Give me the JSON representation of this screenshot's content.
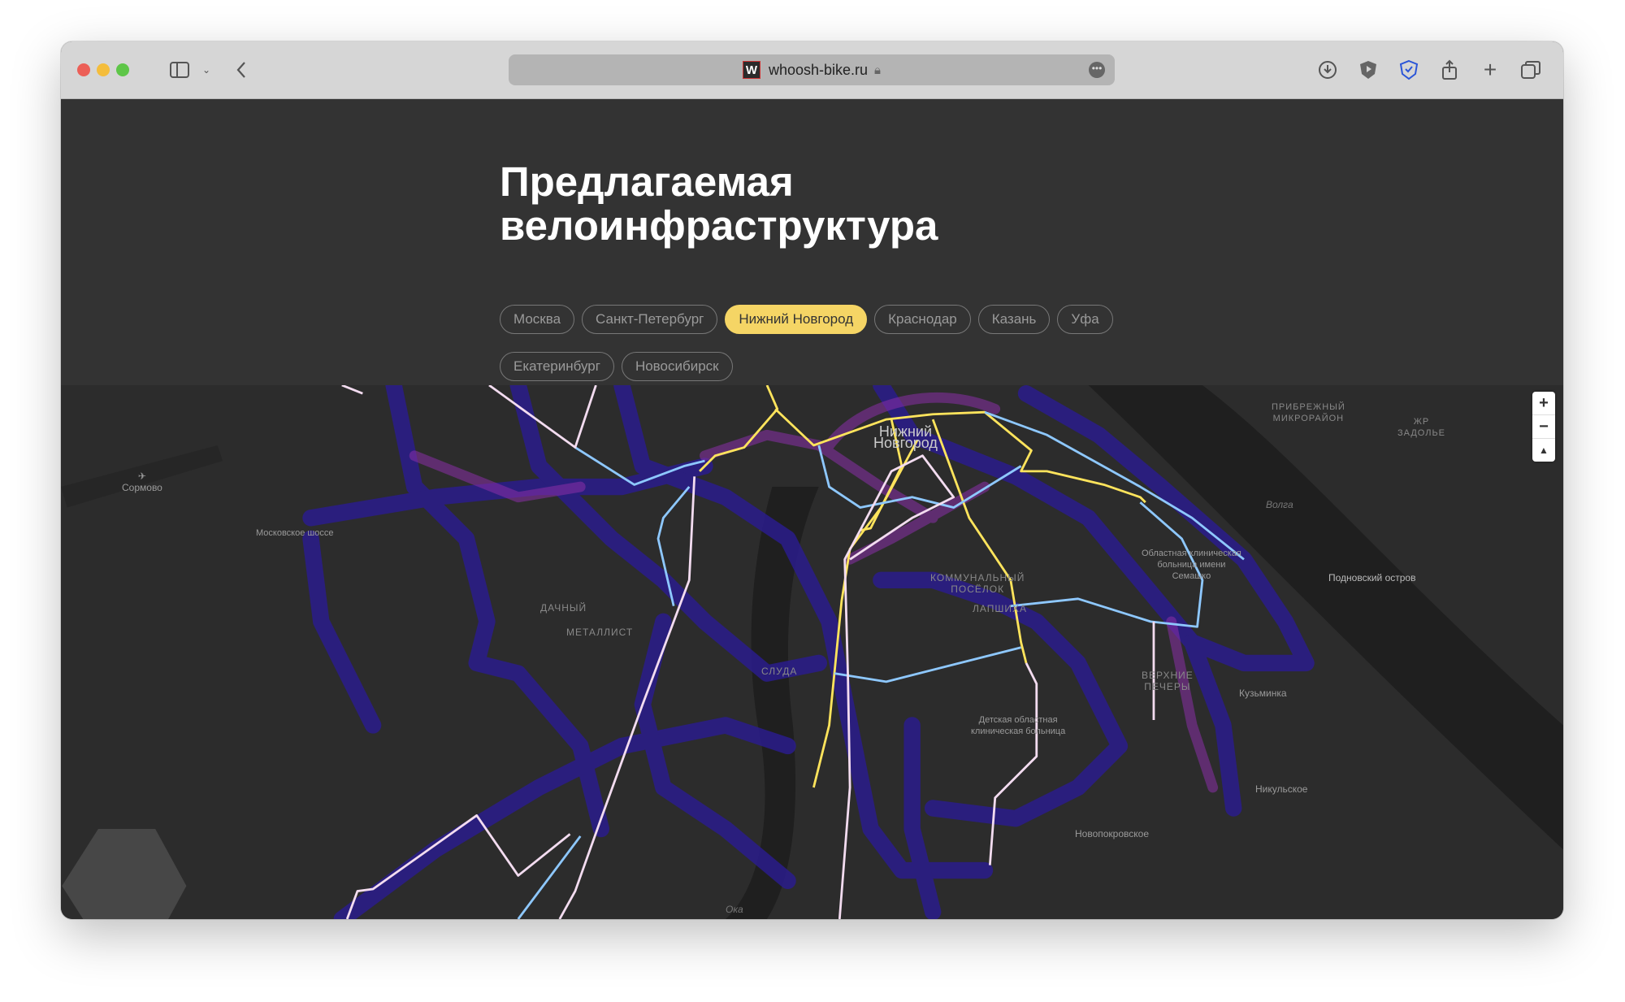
{
  "browser": {
    "url": "whoosh-bike.ru",
    "favicon_letter": "W",
    "icons": [
      "sidebar-icon",
      "chevron-down-icon",
      "back-icon",
      "lock-icon",
      "more-icon",
      "download-icon",
      "shield-icon",
      "password-shield-icon",
      "share-icon",
      "new-tab-icon",
      "tabs-icon"
    ]
  },
  "page": {
    "title_line1": "Предлагаемая",
    "title_line2": "велоинфраструктура",
    "cities": [
      {
        "label": "Москва",
        "active": false
      },
      {
        "label": "Санкт-Петербург",
        "active": false
      },
      {
        "label": "Нижний Новгород",
        "active": true
      },
      {
        "label": "Краснодар",
        "active": false
      },
      {
        "label": "Казань",
        "active": false
      },
      {
        "label": "Уфа",
        "active": false
      },
      {
        "label": "Екатеринбург",
        "active": false
      },
      {
        "label": "Новосибирск",
        "active": false
      }
    ],
    "accent_color": "#f5d565"
  },
  "map": {
    "labels": {
      "city": "Нижний\nНовгород",
      "sormovo": "Сормово",
      "moskovskoe": "Московское шоссе",
      "dachny": "ДАЧНЫЙ",
      "metallist": "МЕТАЛЛИСТ",
      "sluda": "СЛУДА",
      "kommunalny": "КОММУНАЛЬНЫЙ\nПОСЁЛОК",
      "lapshikha": "ЛАПШИХА",
      "hospital_region": "Областная клиническая\nбольница имени\nСемашко",
      "hospital_child": "Детская областная\nклиническая больница",
      "verkhnie": "ВЕРХНИЕ\nПЕЧЕРЫ",
      "kuzminka": "Кузьминка",
      "nikulskoe": "Никульское",
      "novopokrovskoe": "Новопокровское",
      "podnovsky": "Подновский остров",
      "pribrezhny": "ПРИБРЕЖНЫЙ\nМИКРОРАЙОН",
      "zadolye": "ЖР\nЗАДОЛЬЕ",
      "volga": "Волга",
      "oka": "Ока"
    },
    "controls": {
      "zoom_in": "+",
      "zoom_out": "−",
      "compass": "▲"
    },
    "route_colors": {
      "primary": "#ffe45c",
      "secondary": "#8ec8ff",
      "tertiary": "#f3dcf0",
      "heat_low": "#2a1c8c",
      "heat_high": "#9b2fa8"
    }
  }
}
